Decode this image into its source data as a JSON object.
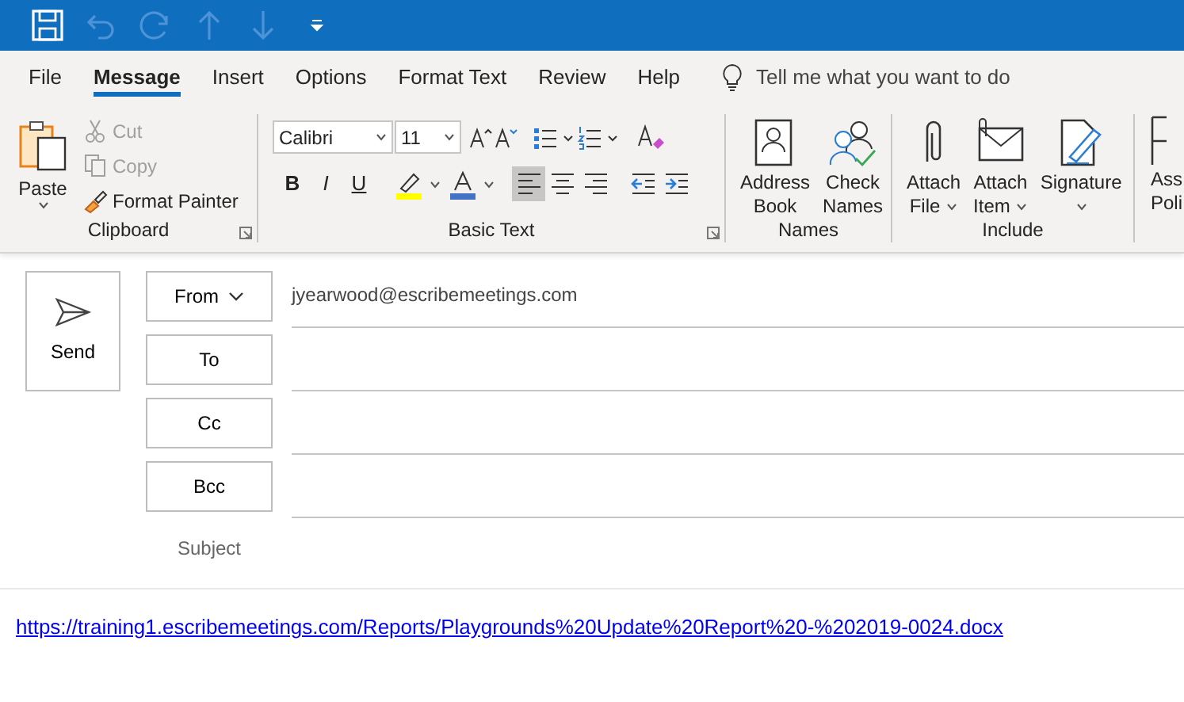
{
  "quick_access": [
    {
      "kind": "save",
      "disabled": false
    },
    {
      "kind": "undo",
      "disabled": true
    },
    {
      "kind": "redo",
      "disabled": true
    },
    {
      "kind": "up",
      "disabled": true
    },
    {
      "kind": "down",
      "disabled": true
    },
    {
      "kind": "customize",
      "disabled": false
    }
  ],
  "tabs": [
    {
      "label": "File",
      "selected": false
    },
    {
      "label": "Message",
      "selected": true
    },
    {
      "label": "Insert",
      "selected": false
    },
    {
      "label": "Options",
      "selected": false
    },
    {
      "label": "Format Text",
      "selected": false
    },
    {
      "label": "Review",
      "selected": false
    },
    {
      "label": "Help",
      "selected": false
    }
  ],
  "tell_me": {
    "placeholder": "Tell me what you want to do"
  },
  "clipboard": {
    "label": "Clipboard",
    "paste": "Paste",
    "items": [
      {
        "kind": "cut",
        "label": "Cut",
        "disabled": true
      },
      {
        "kind": "copy",
        "label": "Copy",
        "disabled": true
      },
      {
        "kind": "painter",
        "label": "Format Painter",
        "disabled": false
      }
    ]
  },
  "basic_text": {
    "label": "Basic Text",
    "font": "Calibri",
    "size": "11",
    "tools": [
      {
        "kind": "bold",
        "label": "B",
        "selected": false
      },
      {
        "kind": "italic",
        "label": "I",
        "selected": false
      },
      {
        "kind": "underline",
        "label": "U",
        "selected": false
      },
      {
        "kind": "highlight",
        "color": "#ffff00",
        "selected": false
      },
      {
        "kind": "font-color",
        "color": "#4472c4",
        "selected": false
      },
      {
        "kind": "align-left",
        "selected": true
      },
      {
        "kind": "align-center",
        "selected": false
      },
      {
        "kind": "align-right",
        "selected": false
      },
      {
        "kind": "outdent",
        "selected": false
      },
      {
        "kind": "indent",
        "selected": false
      }
    ]
  },
  "names": {
    "label": "Names",
    "buttons": [
      {
        "kind": "address-book",
        "lines": [
          "Address",
          "Book"
        ],
        "dropdown": false
      },
      {
        "kind": "check-names",
        "lines": [
          "Check",
          "Names"
        ],
        "dropdown": false
      }
    ]
  },
  "include": {
    "label": "Include",
    "buttons": [
      {
        "kind": "attach-file",
        "lines": [
          "Attach",
          "File"
        ],
        "dropdown": true
      },
      {
        "kind": "attach-item",
        "lines": [
          "Attach",
          "Item"
        ],
        "dropdown": true
      },
      {
        "kind": "signature",
        "lines": [
          "Signature"
        ],
        "dropdown": true
      }
    ]
  },
  "cut_off_group": {
    "lines": [
      "Ass",
      "Poli"
    ]
  },
  "compose": {
    "send": "Send",
    "fields": [
      {
        "label": "From",
        "dropdown": true,
        "value": "jyearwood@escribemeetings.com"
      },
      {
        "label": "To",
        "dropdown": false
      },
      {
        "label": "Cc",
        "dropdown": false
      },
      {
        "label": "Bcc",
        "dropdown": false
      }
    ],
    "subject": "Subject"
  },
  "body": {
    "link": "https://training1.escribemeetings.com/Reports/Playgrounds%20Update%20Report%20-%202019-0024.docx"
  }
}
